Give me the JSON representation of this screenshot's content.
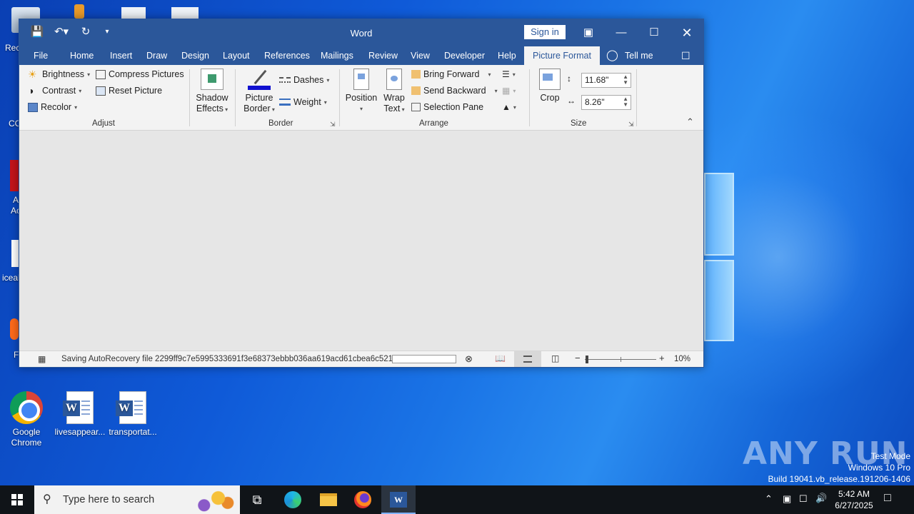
{
  "desktop": {
    "icons": [
      {
        "name": "desktop-icon-google-chrome",
        "label": "Google Chrome"
      },
      {
        "name": "desktop-icon-livesappear",
        "label": "livesappear..."
      },
      {
        "name": "desktop-icon-transportat",
        "label": "transportat..."
      }
    ],
    "partial_labels": {
      "recycle": "Rec",
      "ccleaner": "CC",
      "adobe1": "A",
      "adobe2": "Ac",
      "iceal": "iceal",
      "firefox": "F"
    }
  },
  "word": {
    "title": "Word",
    "sign_in": "Sign in",
    "tabs": [
      "File",
      "Home",
      "Insert",
      "Draw",
      "Design",
      "Layout",
      "References",
      "Mailings",
      "Review",
      "View",
      "Developer",
      "Help",
      "Picture Format"
    ],
    "tell_me": "Tell me",
    "ribbon": {
      "adjust": {
        "brightness": "Brightness",
        "contrast": "Contrast",
        "recolor": "Recolor",
        "compress": "Compress Pictures",
        "reset": "Reset Picture",
        "label": "Adjust"
      },
      "shadow": {
        "line1": "Shadow",
        "line2": "Effects"
      },
      "border": {
        "picture_border_1": "Picture",
        "picture_border_2": "Border",
        "dashes": "Dashes",
        "weight": "Weight",
        "label": "Border"
      },
      "arrange": {
        "position": "Position",
        "wrap_1": "Wrap",
        "wrap_2": "Text",
        "bring_forward": "Bring Forward",
        "send_backward": "Send Backward",
        "selection_pane": "Selection Pane",
        "label": "Arrange"
      },
      "size": {
        "crop": "Crop",
        "height": "11.68\"",
        "width": "8.26\"",
        "label": "Size"
      }
    },
    "status": {
      "text": "Saving AutoRecovery file 2299ff9c7e5995333691f3e68373ebbb036aa619acd61cbea6c521...",
      "zoom": "10%"
    }
  },
  "watermark": {
    "brand": "ANY RUN",
    "line1": "Test Mode",
    "line2": "Windows 10 Pro",
    "line3": "Build 19041.vb_release.191206-1406"
  },
  "taskbar": {
    "search_placeholder": "Type here to search",
    "time": "5:42 AM",
    "date": "6/27/2025"
  },
  "colors": {
    "word_blue": "#2b579a",
    "taskbar": "#101418"
  }
}
